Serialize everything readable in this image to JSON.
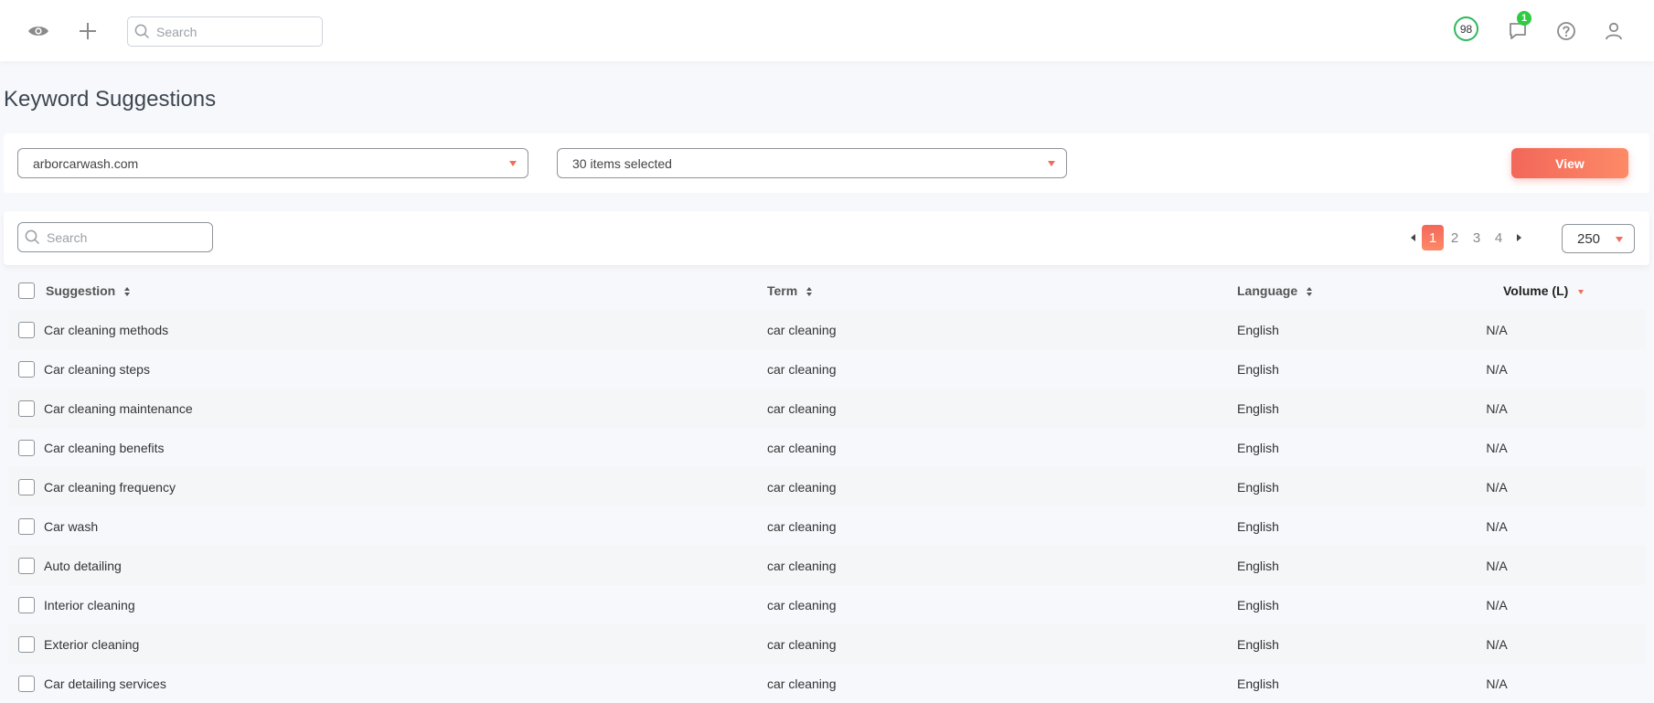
{
  "topbar": {
    "search_placeholder": "Search",
    "score": "98",
    "notification_count": "1"
  },
  "page": {
    "title": "Keyword Suggestions"
  },
  "filters": {
    "domain": "arborcarwash.com",
    "items_selected": "30 items selected",
    "view_label": "View"
  },
  "table_toolbar": {
    "search_placeholder": "Search",
    "pages": [
      "1",
      "2",
      "3",
      "4"
    ],
    "current_page": "1",
    "page_size": "250"
  },
  "table": {
    "columns": {
      "suggestion": "Suggestion",
      "term": "Term",
      "language": "Language",
      "volume": "Volume (L)"
    },
    "rows": [
      {
        "suggestion": "Car cleaning methods",
        "term": "car cleaning",
        "language": "English",
        "volume": "N/A"
      },
      {
        "suggestion": "Car cleaning steps",
        "term": "car cleaning",
        "language": "English",
        "volume": "N/A"
      },
      {
        "suggestion": "Car cleaning maintenance",
        "term": "car cleaning",
        "language": "English",
        "volume": "N/A"
      },
      {
        "suggestion": "Car cleaning benefits",
        "term": "car cleaning",
        "language": "English",
        "volume": "N/A"
      },
      {
        "suggestion": "Car cleaning frequency",
        "term": "car cleaning",
        "language": "English",
        "volume": "N/A"
      },
      {
        "suggestion": "Car wash",
        "term": "car cleaning",
        "language": "English",
        "volume": "N/A"
      },
      {
        "suggestion": "Auto detailing",
        "term": "car cleaning",
        "language": "English",
        "volume": "N/A"
      },
      {
        "suggestion": "Interior cleaning",
        "term": "car cleaning",
        "language": "English",
        "volume": "N/A"
      },
      {
        "suggestion": "Exterior cleaning",
        "term": "car cleaning",
        "language": "English",
        "volume": "N/A"
      },
      {
        "suggestion": "Car detailing services",
        "term": "car cleaning",
        "language": "English",
        "volume": "N/A"
      }
    ]
  },
  "colors": {
    "accent": "#f26b5b",
    "score_ring": "#2eb85c",
    "notification_badge": "#2ecc40"
  },
  "icons": {
    "topbar": [
      "eye-icon",
      "plus-icon",
      "search-icon",
      "chat-icon",
      "help-icon",
      "user-icon"
    ]
  }
}
